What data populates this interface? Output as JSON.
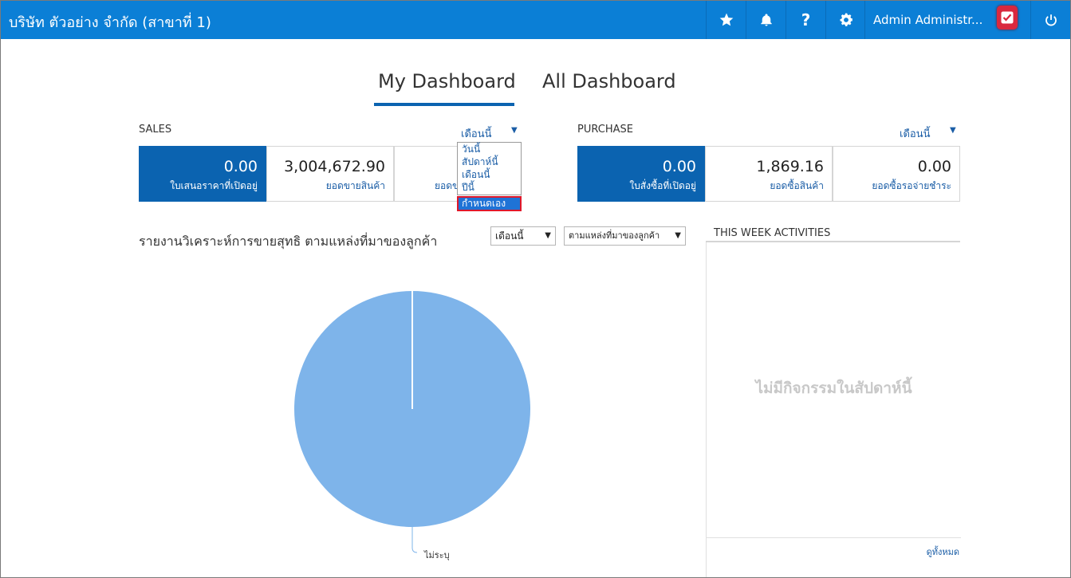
{
  "header": {
    "company": "บริษัท ตัวอย่าง จำกัด (สาขาที่ 1)",
    "user": "Admin Administr...",
    "icons": [
      "star-icon",
      "bell-icon",
      "help-icon",
      "gear-icon",
      "power-icon"
    ],
    "brand_color": "#0b7fd6"
  },
  "tabs": [
    {
      "label": "My Dashboard",
      "active": true
    },
    {
      "label": "All Dashboard",
      "active": false
    }
  ],
  "sales": {
    "title": "SALES",
    "period": "เดือนนี้",
    "dropdown_options": [
      "วันนี้",
      "สัปดาห์นี้",
      "เดือนนี้",
      "ปีนี้",
      "กำหนดเอง"
    ],
    "dropdown_highlighted": "กำหนดเอง",
    "cards": [
      {
        "value": "0.00",
        "label": "ใบเสนอราคาที่เปิดอยู่"
      },
      {
        "value": "3,004,672.90",
        "label": "ยอดขายสินค้า"
      },
      {
        "value": "",
        "label": "ยอดข"
      }
    ]
  },
  "purchase": {
    "title": "PURCHASE",
    "period": "เดือนนี้",
    "cards": [
      {
        "value": "0.00",
        "label": "ใบสั่งซื้อที่เปิดอยู่"
      },
      {
        "value": "1,869.16",
        "label": "ยอดซื้อสินค้า"
      },
      {
        "value": "0.00",
        "label": "ยอดซื้อรอจ่ายชำระ"
      }
    ]
  },
  "report": {
    "title": "รายงานวิเคราะห์การขายสุทธิ ตามแหล่งที่มาของลูกค้า",
    "period_select": "เดือนนี้",
    "source_select": "ตามแหล่งที่มาของลูกค้า"
  },
  "chart_data": {
    "type": "pie",
    "categories": [
      "ไม่ระบุ"
    ],
    "values": [
      100
    ],
    "colors": [
      "#7eb4ea"
    ]
  },
  "activities": {
    "title": "THIS WEEK ACTIVITIES",
    "empty_text": "ไม่มีกิจกรรมในสัปดาห์นี้",
    "view_all": "ดูทั้งหมด"
  }
}
